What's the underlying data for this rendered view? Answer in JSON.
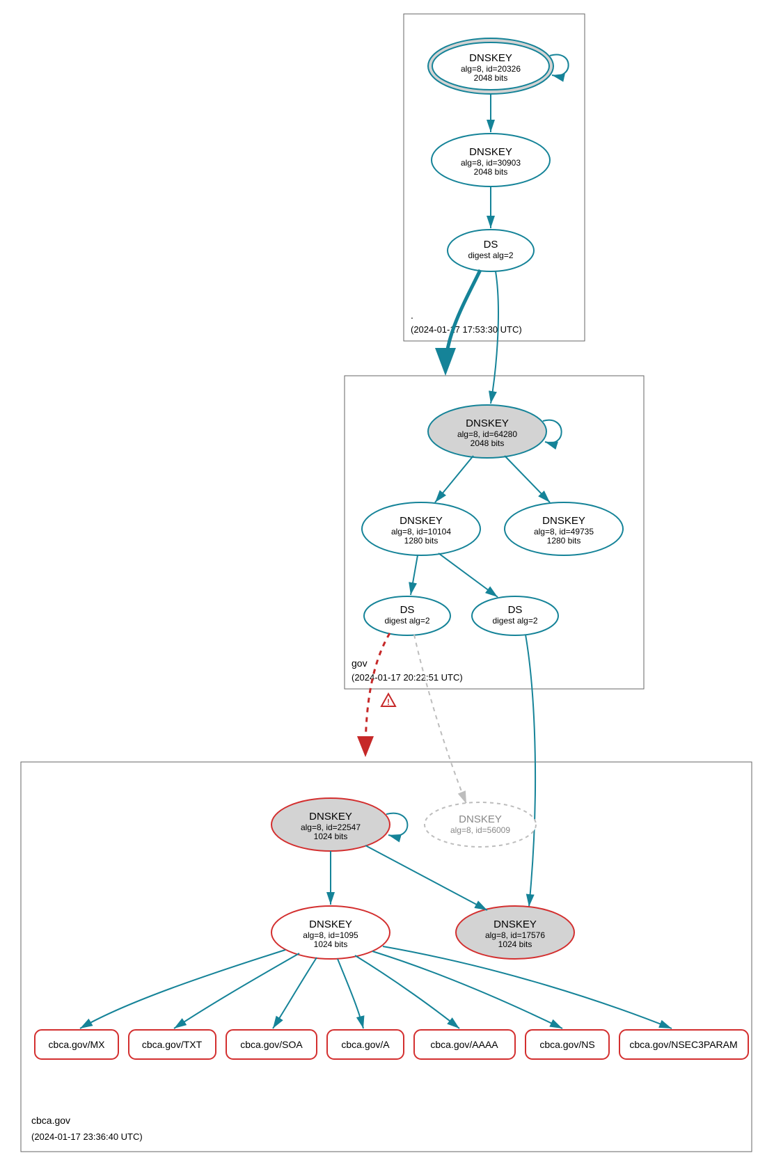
{
  "zones": {
    "root": {
      "label": ".",
      "timestamp": "(2024-01-17 17:53:30 UTC)",
      "nodes": {
        "ksk": {
          "title": "DNSKEY",
          "sub1": "alg=8, id=20326",
          "sub2": "2048 bits"
        },
        "zsk": {
          "title": "DNSKEY",
          "sub1": "alg=8, id=30903",
          "sub2": "2048 bits"
        },
        "ds": {
          "title": "DS",
          "sub1": "digest alg=2"
        }
      }
    },
    "gov": {
      "label": "gov",
      "timestamp": "(2024-01-17 20:22:51 UTC)",
      "nodes": {
        "ksk": {
          "title": "DNSKEY",
          "sub1": "alg=8, id=64280",
          "sub2": "2048 bits"
        },
        "zsk1": {
          "title": "DNSKEY",
          "sub1": "alg=8, id=10104",
          "sub2": "1280 bits"
        },
        "zsk2": {
          "title": "DNSKEY",
          "sub1": "alg=8, id=49735",
          "sub2": "1280 bits"
        },
        "ds1": {
          "title": "DS",
          "sub1": "digest alg=2"
        },
        "ds2": {
          "title": "DS",
          "sub1": "digest alg=2"
        }
      }
    },
    "cbca": {
      "label": "cbca.gov",
      "timestamp": "(2024-01-17 23:36:40 UTC)",
      "nodes": {
        "ksk": {
          "title": "DNSKEY",
          "sub1": "alg=8, id=22547",
          "sub2": "1024 bits"
        },
        "zsk": {
          "title": "DNSKEY",
          "sub1": "alg=8, id=1095",
          "sub2": "1024 bits"
        },
        "key2": {
          "title": "DNSKEY",
          "sub1": "alg=8, id=17576",
          "sub2": "1024 bits"
        },
        "ghost": {
          "title": "DNSKEY",
          "sub1": "alg=8, id=56009"
        }
      },
      "rr": {
        "mx": "cbca.gov/MX",
        "txt": "cbca.gov/TXT",
        "soa": "cbca.gov/SOA",
        "a": "cbca.gov/A",
        "aaaa": "cbca.gov/AAAA",
        "ns": "cbca.gov/NS",
        "nsec3": "cbca.gov/NSEC3PARAM"
      }
    }
  }
}
